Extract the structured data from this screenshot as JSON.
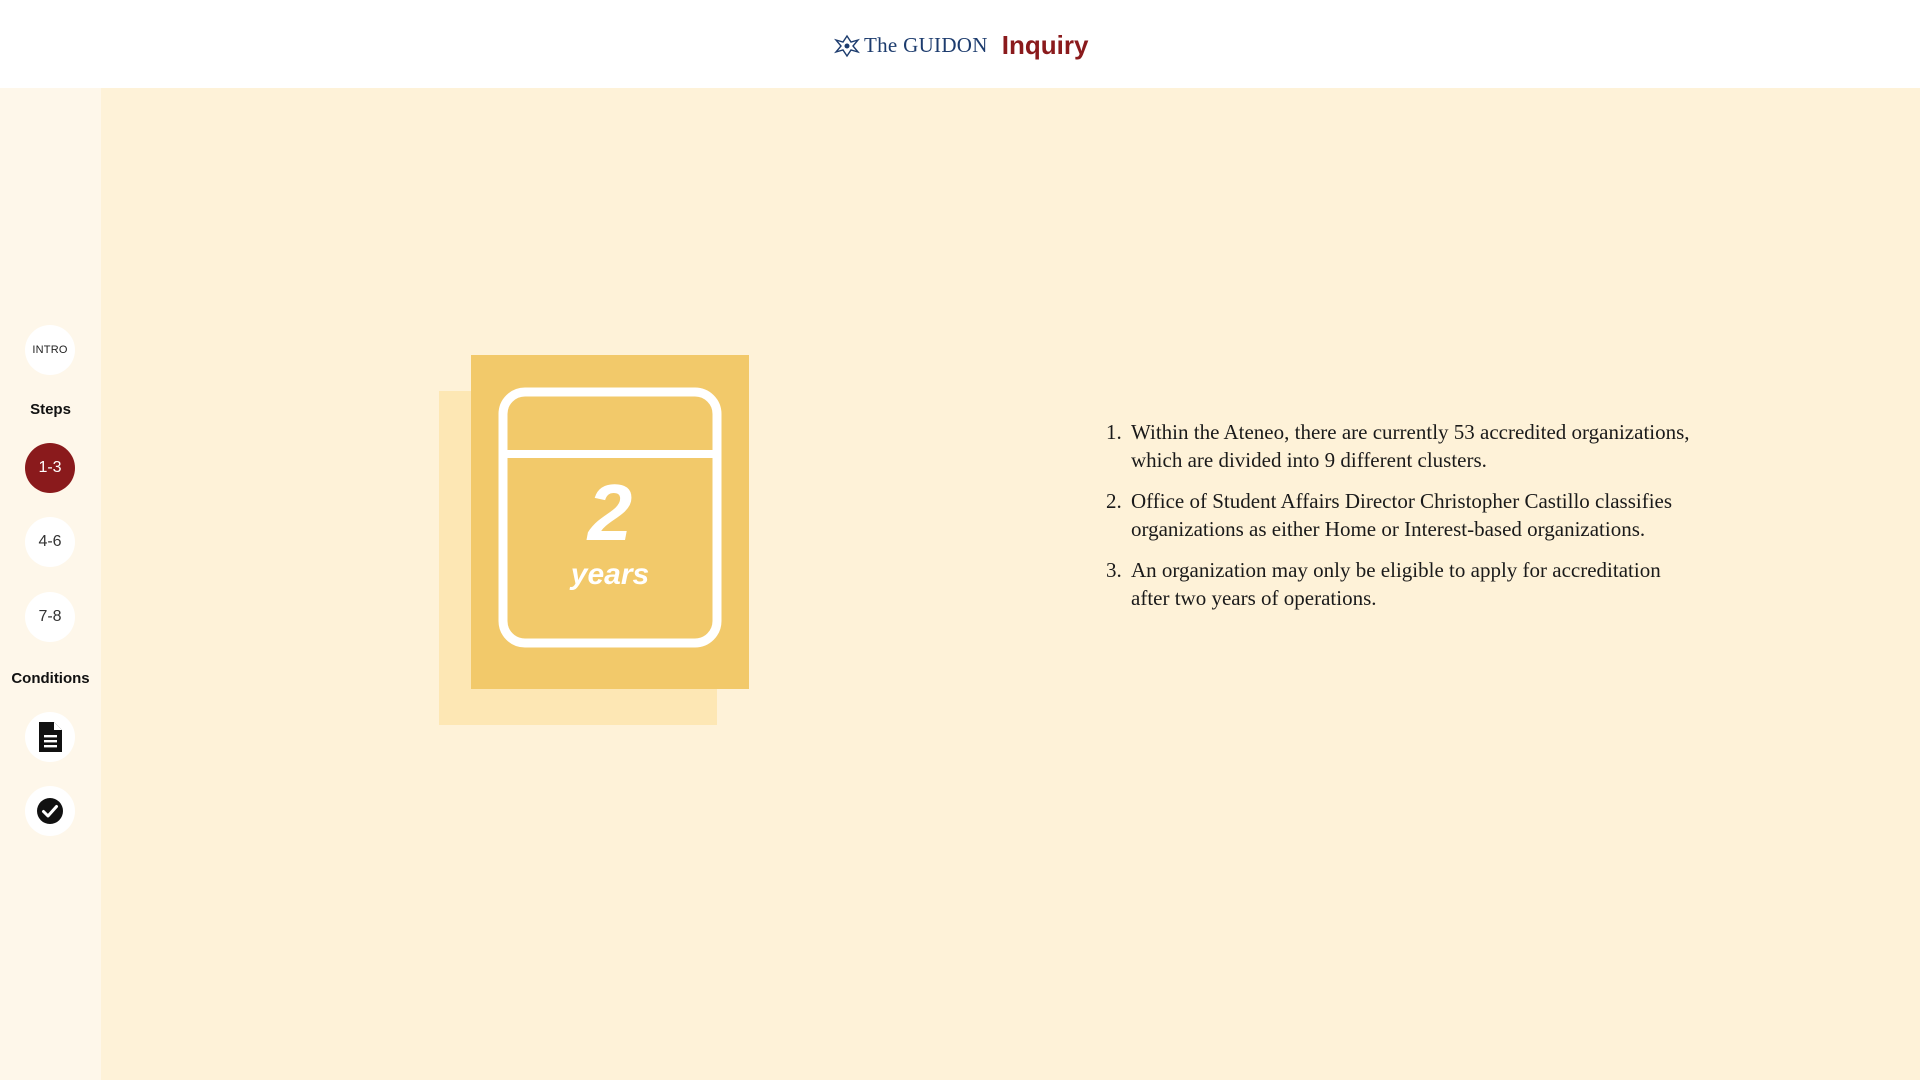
{
  "header": {
    "logo_text": "The GUIDON",
    "section_title": "Inquiry"
  },
  "sidebar": {
    "intro_label": "INTRO",
    "steps_heading": "Steps",
    "steps": [
      {
        "label": "1-3",
        "active": true
      },
      {
        "label": "4-6",
        "active": false
      },
      {
        "label": "7-8",
        "active": false
      }
    ],
    "conditions_heading": "Conditions",
    "condition_icons": [
      "document-icon",
      "check-circle-icon"
    ]
  },
  "figure": {
    "number": "2",
    "unit": "years",
    "icon": "calendar-icon",
    "colors": {
      "card": "#f2c96a",
      "shadow": "#fde7b4",
      "stroke": "#ffffff"
    }
  },
  "facts": [
    "Within the Ateneo, there are currently 53 accredited organizations, which are divided into 9 different clusters.",
    "Office of Student Affairs Director Christopher Castillo classifies organizations as either Home or Interest-based organizations.",
    "An organization may only be eligible to apply for accreditation after two years of operations."
  ],
  "colors": {
    "accent": "#8a1a1c",
    "sidebar_bg": "#fef7ea",
    "main_bg": "#fef2d8",
    "logo": "#1d3c6e"
  }
}
